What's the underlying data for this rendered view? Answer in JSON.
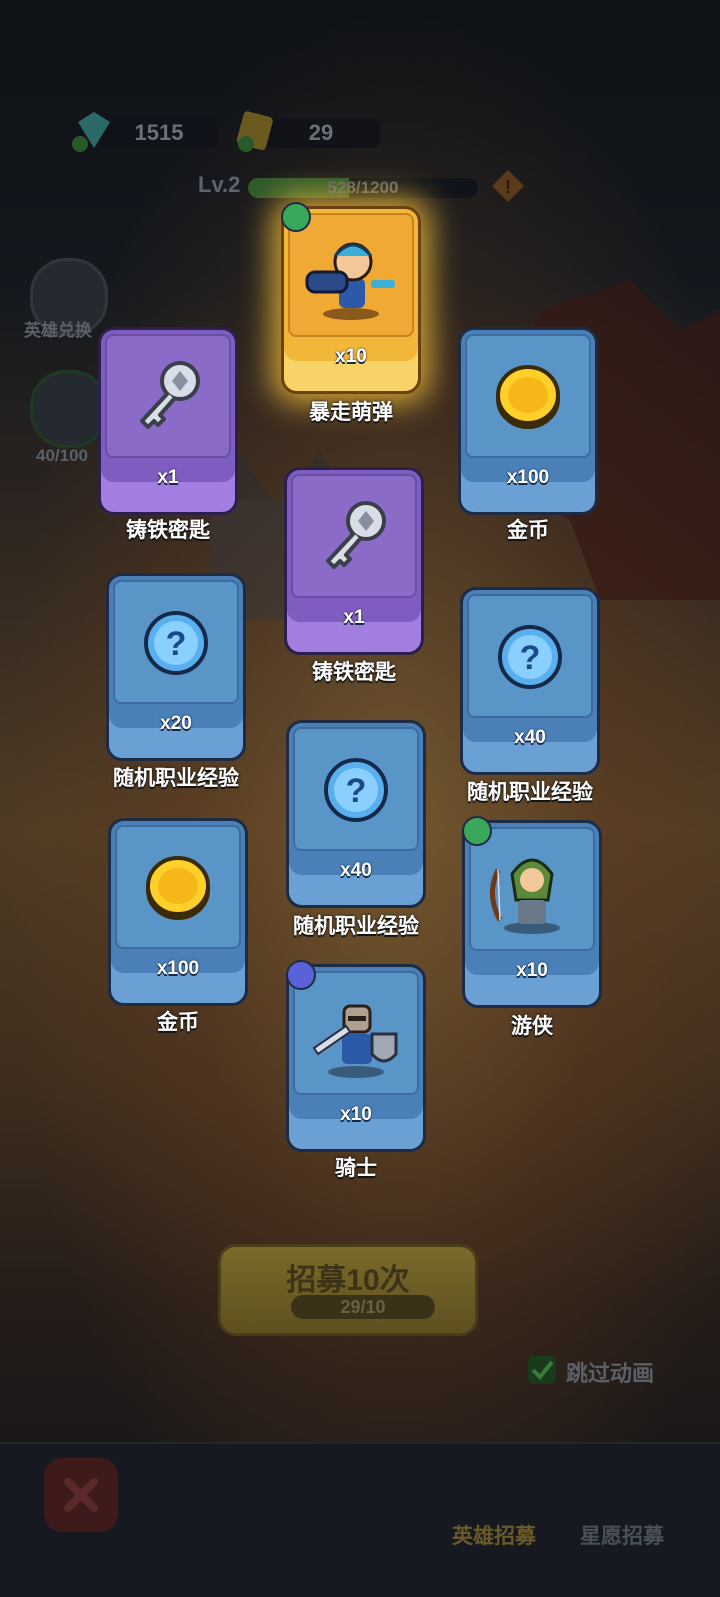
{
  "background": {
    "currency": {
      "gems": "1515",
      "tickets": "29"
    },
    "level": {
      "label": "Lv.2",
      "xp_text": "528/1200",
      "xp_fraction": 0.44
    },
    "side": {
      "hero_exchange": "英雄兑换",
      "progress": "40/100"
    },
    "recruit_button": {
      "label": "招募10次",
      "count": "29/10"
    },
    "skip_animation": "跳过动画",
    "tabs": {
      "hero_recruit": "英雄招募",
      "star_recruit": "星愿招募"
    },
    "accent": "#f2b638"
  },
  "rewards": [
    {
      "name": "暴走萌弹",
      "qty": "x10",
      "rarity": "gold",
      "icon": "hero-bomber-icon",
      "badge": "archer-class-badge"
    },
    {
      "name": "铸铁密匙",
      "qty": "x1",
      "rarity": "purple",
      "icon": "iron-key-icon"
    },
    {
      "name": "金币",
      "qty": "x100",
      "rarity": "blue",
      "icon": "gold-coin-icon"
    },
    {
      "name": "铸铁密匙",
      "qty": "x1",
      "rarity": "purple",
      "icon": "iron-key-icon"
    },
    {
      "name": "随机职业经验",
      "qty": "x20",
      "rarity": "blue",
      "icon": "question-orb-icon"
    },
    {
      "name": "随机职业经验",
      "qty": "x40",
      "rarity": "blue",
      "icon": "question-orb-icon"
    },
    {
      "name": "随机职业经验",
      "qty": "x40",
      "rarity": "blue",
      "icon": "question-orb-icon"
    },
    {
      "name": "金币",
      "qty": "x100",
      "rarity": "blue",
      "icon": "gold-coin-icon"
    },
    {
      "name": "游侠",
      "qty": "x10",
      "rarity": "blue",
      "icon": "hero-ranger-icon",
      "badge": "archer-class-badge"
    },
    {
      "name": "骑士",
      "qty": "x10",
      "rarity": "blue",
      "icon": "hero-knight-icon",
      "badge": "warrior-class-badge"
    }
  ]
}
